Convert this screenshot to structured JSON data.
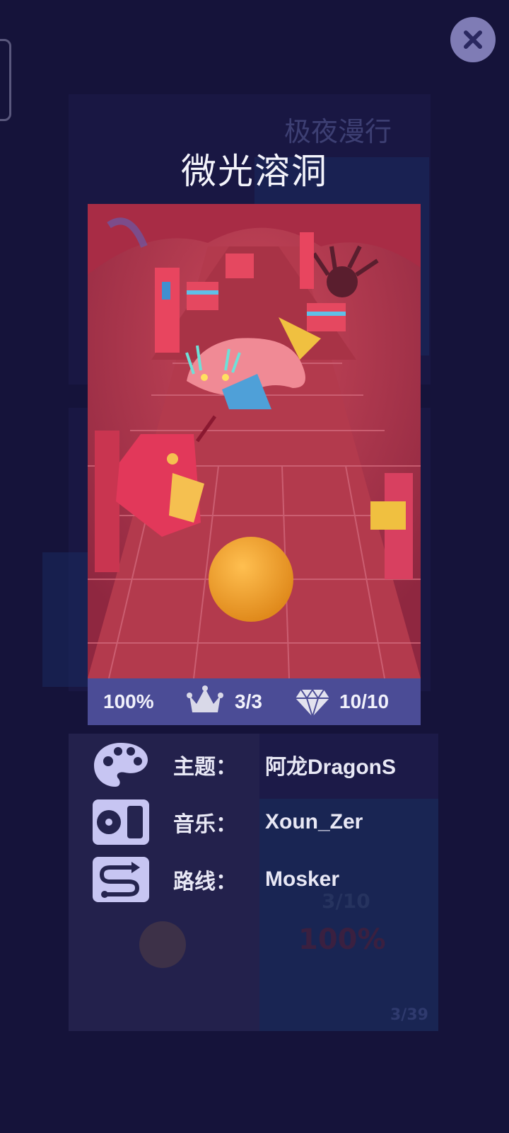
{
  "level": {
    "title": "微光溶洞"
  },
  "stats": {
    "percent": "100%",
    "crowns": "3/3",
    "gems": "10/10"
  },
  "info": [
    {
      "icon": "palette-icon",
      "label": "主题：",
      "value": "阿龙DragonS"
    },
    {
      "icon": "music-player-icon",
      "label": "音乐：",
      "value": "Xoun_Zer"
    },
    {
      "icon": "route-icon",
      "label": "路线：",
      "value": "Mosker"
    }
  ],
  "background": {
    "faded_title": "极夜漫行",
    "faded_gems": "3/10",
    "faded_percent": "100%",
    "faded_page": "3/39"
  },
  "colors": {
    "background": "#15133a",
    "stats_bar": "#4b4c96",
    "close_button": "#7f7cb5",
    "ball": "#f0a030"
  }
}
